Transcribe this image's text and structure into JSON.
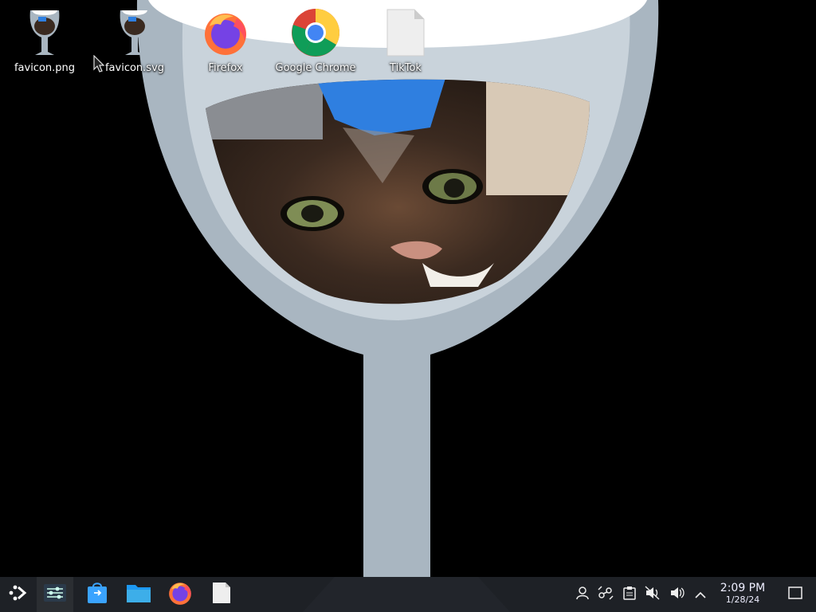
{
  "desktop": {
    "icons": [
      {
        "label": "favicon.png",
        "icon": "wine-glass-icon"
      },
      {
        "label": "favicon.svg",
        "icon": "wine-glass-icon"
      },
      {
        "label": "Firefox",
        "icon": "firefox-icon"
      },
      {
        "label": "Google Chrome",
        "icon": "chrome-icon"
      },
      {
        "label": "TikTok",
        "icon": "blank-file-icon"
      }
    ]
  },
  "taskbar": {
    "launchers": [
      "app-launcher-icon",
      "settings-icon",
      "discover-store-icon",
      "folder-icon",
      "firefox-icon",
      "blank-file-icon"
    ],
    "tray": [
      "user-icon",
      "kde-connect-icon",
      "clipboard-icon",
      "muted-speaker-icon",
      "volume-icon",
      "chevron-up-icon"
    ],
    "clock": {
      "time": "2:09 PM",
      "date": "1/28/24"
    },
    "show_desktop": "show-desktop-icon"
  },
  "colors": {
    "glass": "#a9b6c1",
    "glass_rim": "#ffffff",
    "background": "#000000",
    "taskbar": "#202429"
  }
}
